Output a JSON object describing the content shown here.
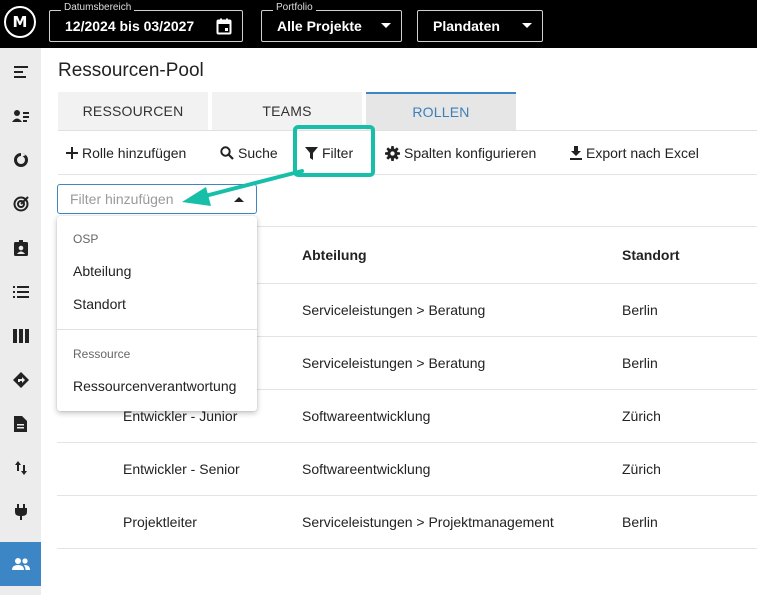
{
  "app": {
    "logo_text": "M"
  },
  "header": {
    "date_range": {
      "legend": "Datumsbereich",
      "value": "12/2024 bis 03/2027"
    },
    "portfolio": {
      "legend": "Portfolio",
      "value": "Alle Projekte"
    },
    "data_source": {
      "value": "Plandaten"
    }
  },
  "sidebar": {
    "items": [
      {
        "icon": "menu-collapse-icon"
      },
      {
        "icon": "person-list-icon"
      },
      {
        "icon": "progress-icon"
      },
      {
        "icon": "target-icon"
      },
      {
        "icon": "contact-badge-icon"
      },
      {
        "icon": "list-icon"
      },
      {
        "icon": "columns-icon"
      },
      {
        "icon": "direction-icon"
      },
      {
        "icon": "document-icon"
      },
      {
        "icon": "swap-vertical-icon"
      },
      {
        "icon": "plug-icon"
      },
      {
        "icon": "people-icon",
        "active": true
      }
    ]
  },
  "page": {
    "title": "Ressourcen-Pool"
  },
  "tabs": [
    {
      "label": "RESSOURCEN",
      "active": false
    },
    {
      "label": "TEAMS",
      "active": false
    },
    {
      "label": "ROLLEN",
      "active": true
    }
  ],
  "toolbar": {
    "add_role": "Rolle hinzufügen",
    "search": "Suche",
    "filter": "Filter",
    "configure_columns": "Spalten konfigurieren",
    "export_excel": "Export nach Excel"
  },
  "filter_input": {
    "placeholder": "Filter hinzufügen"
  },
  "filter_dropdown": {
    "groups": [
      {
        "label": "OSP",
        "items": [
          "Abteilung",
          "Standort"
        ]
      },
      {
        "label": "Ressource",
        "items": [
          "Ressourcenverantwortung"
        ]
      }
    ]
  },
  "table": {
    "columns": {
      "dept": "Abteilung",
      "location": "Standort"
    },
    "rows": [
      {
        "name": "",
        "dept": "Serviceleistungen > Beratung",
        "location": "Berlin"
      },
      {
        "name": "",
        "dept": "Serviceleistungen > Beratung",
        "location": "Berlin"
      },
      {
        "name": "Entwickler - Junior",
        "dept": "Softwareentwicklung",
        "location": "Zürich"
      },
      {
        "name": "Entwickler - Senior",
        "dept": "Softwareentwicklung",
        "location": "Zürich"
      },
      {
        "name": "Projektleiter",
        "dept": "Serviceleistungen > Projektmanagement",
        "location": "Berlin"
      }
    ]
  },
  "colors": {
    "accent": "#3d86c6",
    "highlight": "#18bfa8",
    "topbar": "#000000",
    "sidebar": "#ececec"
  }
}
